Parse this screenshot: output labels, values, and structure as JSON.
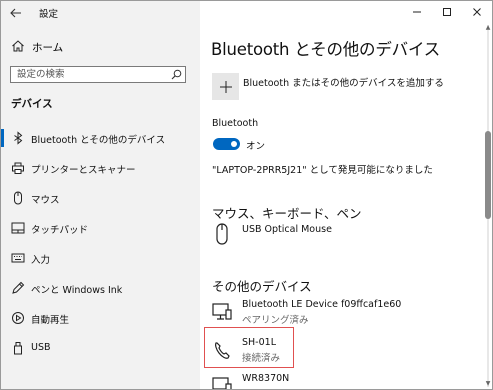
{
  "app": {
    "title": "設定"
  },
  "sidebar": {
    "home_label": "ホーム",
    "search_placeholder": "設定の検索",
    "section_title": "デバイス",
    "items": [
      {
        "label": "Bluetooth とその他のデバイス",
        "icon": "bluetooth-icon",
        "active": true
      },
      {
        "label": "プリンターとスキャナー",
        "icon": "printer-icon"
      },
      {
        "label": "マウス",
        "icon": "mouse-icon"
      },
      {
        "label": "タッチパッド",
        "icon": "touchpad-icon"
      },
      {
        "label": "入力",
        "icon": "keyboard-icon"
      },
      {
        "label": "ペンと Windows Ink",
        "icon": "pen-icon"
      },
      {
        "label": "自動再生",
        "icon": "autoplay-icon"
      },
      {
        "label": "USB",
        "icon": "usb-icon"
      }
    ]
  },
  "main": {
    "title": "Bluetooth とその他のデバイス",
    "add_device_label": "Bluetooth またはその他のデバイスを追加する",
    "bluetooth_label": "Bluetooth",
    "toggle_label": "オン",
    "toggle_on": true,
    "discoverable_text": "\"LAPTOP-2PRR5J21\" として発見可能になりました",
    "mouse_section": {
      "title": "マウス、キーボード、ペン",
      "devices": [
        {
          "name": "USB Optical Mouse",
          "icon": "mouse-icon"
        }
      ]
    },
    "other_section": {
      "title": "その他のデバイス",
      "devices": [
        {
          "name": "Bluetooth LE Device f09ffcaf1e60",
          "status": "ペアリング済み",
          "icon": "device-icon"
        },
        {
          "name": "SH-01L",
          "status": "接続済み",
          "icon": "phone-icon",
          "selected": true
        },
        {
          "name": "WR8370N",
          "status": "",
          "icon": "device-icon"
        }
      ]
    }
  },
  "colors": {
    "accent": "#0067c0",
    "selection_outline": "#e05050",
    "sidebar_bg": "#f2f2f2"
  }
}
